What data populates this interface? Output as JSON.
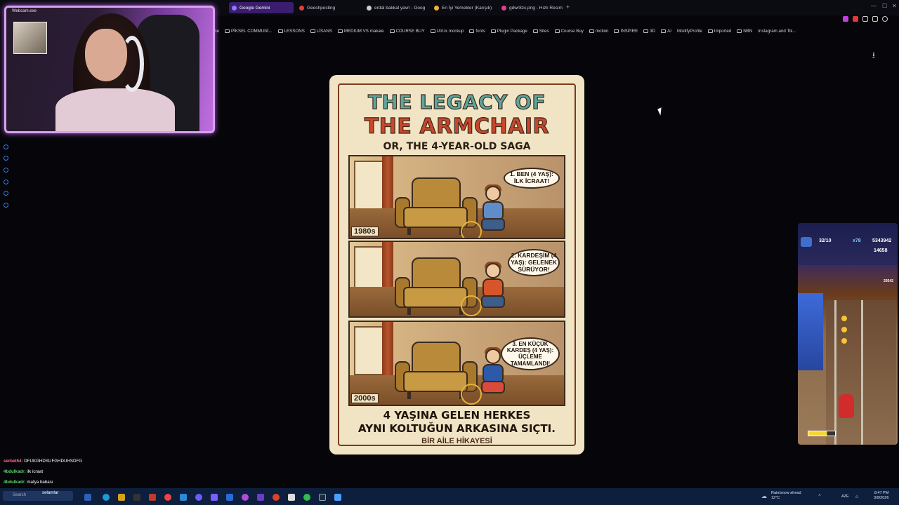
{
  "browser": {
    "tabs": [
      {
        "label": "Google Gemini",
        "active": true,
        "color": "#8b7cff"
      },
      {
        "label": "Geeshposting",
        "active": false,
        "color": "#e0403a"
      },
      {
        "label": "erdal bakkal yavri - Goog",
        "active": false,
        "color": "#cccccc"
      },
      {
        "label": "En İyi Yemekler (Karışık)",
        "active": false,
        "color": "#f2b234"
      },
      {
        "label": "gdwr8zc.png - Hızlı Resim",
        "active": false,
        "color": "#e04090"
      }
    ],
    "bookmarks": [
      "ame",
      "PİKSEL COMMUNİ...",
      "LESSONS",
      "LİSANS",
      "MEDIUM VS makale",
      "COURSE BUY",
      "UI/Ux mockup",
      "fonts",
      "Plugin Package",
      "Sites",
      "Course Buy",
      "motion",
      "INSPIRE",
      "3D",
      "AI",
      "ModifyProfile",
      "Imported",
      "NBN",
      "Instagram and Tik..."
    ]
  },
  "webcam": {
    "title": "Webcam.exe"
  },
  "poster": {
    "title_line1": "THE LEGACY OF",
    "title_line2": "THE ARMCHAIR",
    "subtitle": "OR, THE 4-YEAR-OLD SAGA",
    "panels": [
      {
        "bubble": "1. BEN (4 YAŞ): İLK İCRAAT!",
        "year": "1980s",
        "shirt": "#5f8dc9"
      },
      {
        "bubble": "2. KARDEŞİM (4 YAŞ): GELENEK SÜRÜYOR!",
        "year": "",
        "shirt": "#d8552a"
      },
      {
        "bubble": "3. EN KÜÇÜK KARDEŞ (4 YAŞ): ÜÇLEME TAMAMLANDI!",
        "year": "2000s",
        "shirt": "#2c5aa8"
      }
    ],
    "footer_line1": "4 YAŞINA GELEN HERKES",
    "footer_line2": "AYNI KOLTUĞUN ARKASINA SIÇTI.",
    "footer_line3": "BİR AİLE HİKAYESİ"
  },
  "game": {
    "progress": "32/10",
    "multiplier": "x78",
    "score": "5343942",
    "coins": "14658",
    "side_count": "20542",
    "boost_level": 0.7
  },
  "chat": [
    {
      "user": "serbet64:",
      "message": "DFUKGHDSUFGHDUHSDFG",
      "color": "#ff6a8a"
    },
    {
      "user": "4bdulkadr:",
      "message": "ilk icraat",
      "color": "#5ad36a"
    },
    {
      "user": "4bdulkadr:",
      "message": "mafya babası",
      "color": "#5ad36a"
    },
    {
      "user": "",
      "message": "selamlar",
      "color": "#5ad36a"
    }
  ],
  "taskbar": {
    "search_placeholder": "Search",
    "weather_line1": "Rain/snow ahead",
    "weather_line2": "12°C",
    "lang": "AZE",
    "time": "8:47 PM",
    "date": "3/9/2026"
  }
}
